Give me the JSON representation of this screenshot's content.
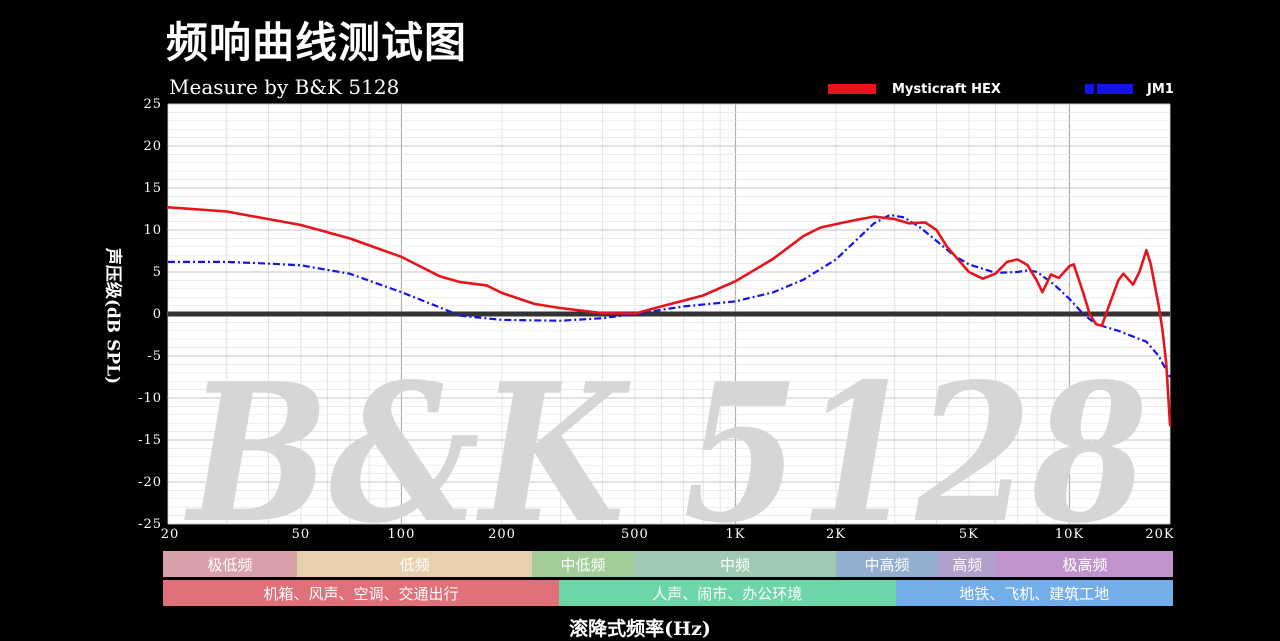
{
  "title": "频响曲线测试图",
  "subtitle": "Measure by B&K 5128",
  "watermark": "B&K 5128",
  "legend": [
    {
      "name": "Mysticraft HEX",
      "color": "#e8141c"
    },
    {
      "name": "JM1",
      "color": "#1414e8"
    }
  ],
  "chart_data": {
    "type": "line",
    "xscale": "log",
    "xlim": [
      20,
      20000
    ],
    "ylim": [
      -25,
      25
    ],
    "ylabel": "声压级(dB SPL)",
    "xlabel": "滚降式频率(Hz)",
    "grid": true,
    "x_ticks": [
      "20",
      "50",
      "100",
      "200",
      "500",
      "1K",
      "2K",
      "5K",
      "10K",
      "20K"
    ],
    "y_ticks": [
      "25",
      "20",
      "15",
      "10",
      "5",
      "0",
      "-5",
      "-10",
      "-15",
      "-20",
      "-25"
    ],
    "series": [
      {
        "name": "Mysticraft HEX",
        "color": "#e8141c",
        "style": "solid",
        "points": [
          [
            20,
            12.7
          ],
          [
            30,
            12.2
          ],
          [
            40,
            11.3
          ],
          [
            50,
            10.6
          ],
          [
            70,
            9.0
          ],
          [
            100,
            6.8
          ],
          [
            130,
            4.5
          ],
          [
            150,
            3.8
          ],
          [
            180,
            3.4
          ],
          [
            200,
            2.5
          ],
          [
            250,
            1.2
          ],
          [
            300,
            0.7
          ],
          [
            400,
            0.1
          ],
          [
            500,
            0.05
          ],
          [
            600,
            0.9
          ],
          [
            800,
            2.2
          ],
          [
            1000,
            3.9
          ],
          [
            1300,
            6.6
          ],
          [
            1600,
            9.3
          ],
          [
            1800,
            10.3
          ],
          [
            2000,
            10.7
          ],
          [
            2300,
            11.2
          ],
          [
            2600,
            11.6
          ],
          [
            3000,
            11.3
          ],
          [
            3300,
            10.8
          ],
          [
            3700,
            10.9
          ],
          [
            4000,
            10.0
          ],
          [
            4300,
            8.0
          ],
          [
            5000,
            5.0
          ],
          [
            5500,
            4.2
          ],
          [
            6000,
            4.8
          ],
          [
            6500,
            6.2
          ],
          [
            7000,
            6.5
          ],
          [
            7500,
            5.8
          ],
          [
            8000,
            3.9
          ],
          [
            8300,
            2.6
          ],
          [
            8800,
            4.7
          ],
          [
            9300,
            4.3
          ],
          [
            10000,
            5.7
          ],
          [
            10300,
            5.9
          ],
          [
            11000,
            2.5
          ],
          [
            11500,
            0.0
          ],
          [
            12000,
            -1.2
          ],
          [
            12500,
            -1.4
          ],
          [
            13000,
            0.5
          ],
          [
            14000,
            4.0
          ],
          [
            14500,
            4.8
          ],
          [
            15500,
            3.5
          ],
          [
            16200,
            5.0
          ],
          [
            17000,
            7.6
          ],
          [
            17500,
            6.0
          ],
          [
            18500,
            1.0
          ],
          [
            19000,
            -2.0
          ],
          [
            19500,
            -6.0
          ],
          [
            20000,
            -13.2
          ]
        ]
      },
      {
        "name": "JM1",
        "color": "#1414e8",
        "style": "dashdot",
        "points": [
          [
            20,
            6.2
          ],
          [
            30,
            6.2
          ],
          [
            40,
            6.0
          ],
          [
            50,
            5.8
          ],
          [
            70,
            4.8
          ],
          [
            100,
            2.6
          ],
          [
            130,
            0.8
          ],
          [
            150,
            -0.2
          ],
          [
            200,
            -0.7
          ],
          [
            300,
            -0.8
          ],
          [
            400,
            -0.5
          ],
          [
            500,
            0.0
          ],
          [
            700,
            0.9
          ],
          [
            1000,
            1.5
          ],
          [
            1300,
            2.6
          ],
          [
            1600,
            4.1
          ],
          [
            2000,
            6.5
          ],
          [
            2300,
            8.8
          ],
          [
            2600,
            10.8
          ],
          [
            2900,
            11.8
          ],
          [
            3200,
            11.5
          ],
          [
            3600,
            10.2
          ],
          [
            4000,
            8.7
          ],
          [
            4500,
            7.0
          ],
          [
            5000,
            5.9
          ],
          [
            6000,
            4.9
          ],
          [
            7000,
            5.0
          ],
          [
            7500,
            5.2
          ],
          [
            8000,
            5.0
          ],
          [
            9000,
            3.5
          ],
          [
            10000,
            1.8
          ],
          [
            11000,
            0.0
          ],
          [
            12000,
            -1.2
          ],
          [
            14000,
            -2.0
          ],
          [
            17000,
            -3.3
          ],
          [
            18500,
            -5.0
          ],
          [
            20000,
            -7.5
          ]
        ]
      },
      {
        "name": "",
        "color": "#333333",
        "style": "reference",
        "points": [
          [
            20,
            0
          ],
          [
            20000,
            0
          ]
        ]
      }
    ]
  },
  "bands": [
    {
      "label": "极低频",
      "color": "#d8a0a8",
      "from": 20,
      "to": 50
    },
    {
      "label": "低频",
      "color": "#e6d0ad",
      "from": 50,
      "to": 250
    },
    {
      "label": "中低频",
      "color": "#a2cd98",
      "from": 250,
      "to": 500
    },
    {
      "label": "中频",
      "color": "#a0c9b4",
      "from": 500,
      "to": 2000
    },
    {
      "label": "中高频",
      "color": "#94aed0",
      "from": 2000,
      "to": 4000
    },
    {
      "label": "高频",
      "color": "#b09ecb",
      "from": 4000,
      "to": 6000
    },
    {
      "label": "极高频",
      "color": "#c093cd",
      "from": 6000,
      "to": 20000
    }
  ],
  "scenes": [
    {
      "label": "机箱、风声、空调、交通出行",
      "color": "#e0707a",
      "from": 20,
      "to": 300
    },
    {
      "label": "人声、闹市、办公环境",
      "color": "#6dd5a7",
      "from": 300,
      "to": 3000
    },
    {
      "label": "地铁、飞机、建筑工地",
      "color": "#74aee8",
      "from": 3000,
      "to": 20000
    }
  ]
}
